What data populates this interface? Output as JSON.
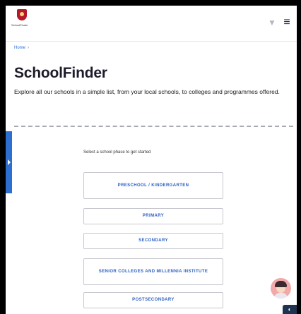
{
  "header": {
    "logo_text": "SchoolFinder",
    "search_icon": "search-icon",
    "menu_icon": "menu-icon"
  },
  "breadcrumb": {
    "home": "Home",
    "separator": "›"
  },
  "page": {
    "title": "SchoolFinder",
    "intro": "Explore all our schools in a simple list, from your local schools, to colleges and programmes offered."
  },
  "selection": {
    "prompt": "Select a school phase to get started",
    "options": [
      "Preschool / Kindergarten",
      "Primary",
      "Secondary",
      "Senior Colleges and Millennia Institute",
      "Postsecondary"
    ]
  },
  "colors": {
    "accent": "#2b5fc4",
    "side_tab": "#2d6fd1",
    "title": "#1c1c2b"
  }
}
